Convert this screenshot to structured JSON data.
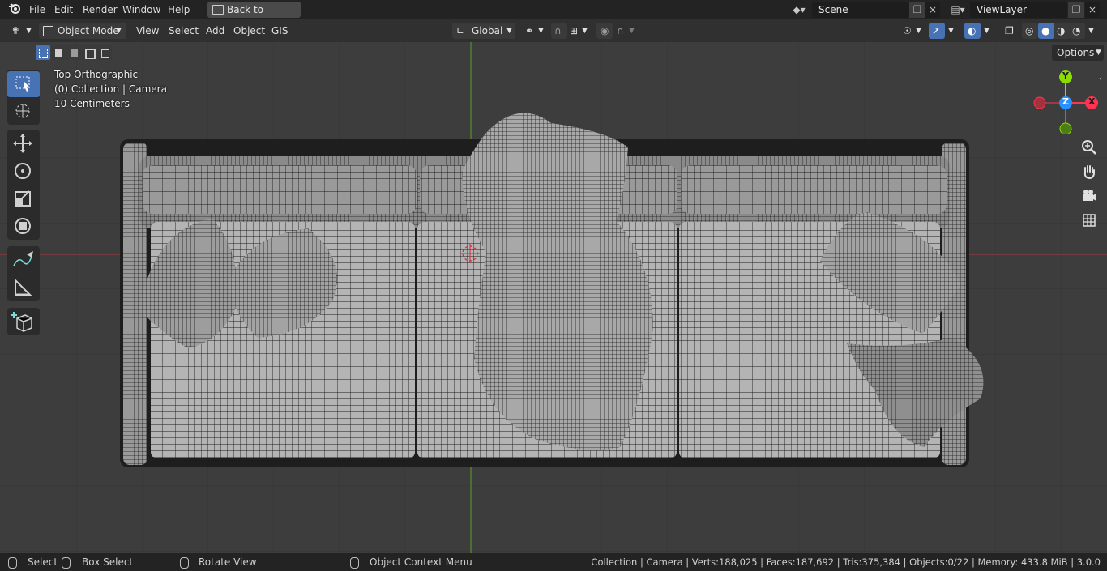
{
  "menubar": {
    "items": [
      "File",
      "Edit",
      "Render",
      "Window",
      "Help"
    ],
    "back_label": "Back to Previous",
    "scene_label": "Scene",
    "viewlayer_label": "ViewLayer"
  },
  "header": {
    "mode_label": "Object Mode",
    "menus": [
      "View",
      "Select",
      "Add",
      "Object",
      "GIS"
    ],
    "transform_orientation": "Global",
    "options_label": "Options"
  },
  "viewport": {
    "view_name": "Top Orthographic",
    "collection_info": "(0) Collection | Camera",
    "scale_info": "10 Centimeters",
    "gizmo": {
      "y": "Y",
      "z": "Z",
      "x": "X"
    }
  },
  "statusbar": {
    "select": "Select",
    "box_select": "Box Select",
    "rotate_view": "Rotate View",
    "context_menu": "Object Context Menu",
    "stats": "Collection | Camera | Verts:188,025 | Faces:187,692 | Tris:375,384 | Objects:0/22 | Memory: 433.8 MiB | 3.0.0"
  },
  "colors": {
    "accent": "#4772b3",
    "x_axis": "#ff3352",
    "y_axis": "#8bdc00",
    "z_axis": "#2890ff"
  }
}
